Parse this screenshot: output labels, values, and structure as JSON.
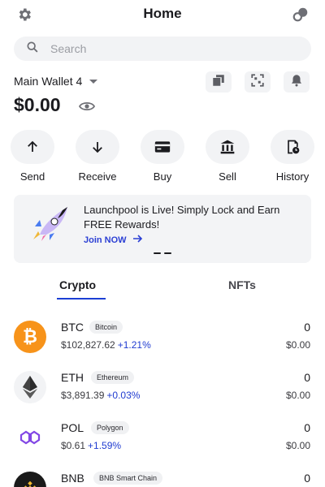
{
  "header": {
    "title": "Home",
    "settings_icon": "gear-icon",
    "connect_icon": "link-icon"
  },
  "search": {
    "placeholder": "Search",
    "icon": "search-icon"
  },
  "wallet": {
    "name": "Main Wallet 4",
    "balance": "$0.00",
    "actions_icons": [
      "copy-icon",
      "scan-icon",
      "bell-icon"
    ]
  },
  "actions": [
    {
      "label": "Send",
      "icon": "arrow-up-icon"
    },
    {
      "label": "Receive",
      "icon": "arrow-down-icon"
    },
    {
      "label": "Buy",
      "icon": "card-icon"
    },
    {
      "label": "Sell",
      "icon": "bank-icon"
    },
    {
      "label": "History",
      "icon": "history-icon"
    }
  ],
  "banner": {
    "text": "Launchpool is Live! Simply Lock and Earn FREE Rewards!",
    "cta": "Join NOW"
  },
  "tabs": [
    {
      "label": "Crypto",
      "active": true
    },
    {
      "label": "NFTs",
      "active": false
    }
  ],
  "assets": [
    {
      "symbol": "BTC",
      "name": "Bitcoin",
      "price": "$102,827.62",
      "change": "+1.21%",
      "amount": "0",
      "value": "$0.00",
      "color": "#f7931a"
    },
    {
      "symbol": "ETH",
      "name": "Ethereum",
      "price": "$3,891.39",
      "change": "+0.03%",
      "amount": "0",
      "value": "$0.00",
      "color": "#2c2c2c"
    },
    {
      "symbol": "POL",
      "name": "Polygon",
      "price": "$0.61",
      "change": "+1.59%",
      "amount": "0",
      "value": "$0.00",
      "color": "#8247e5"
    },
    {
      "symbol": "BNB",
      "name": "BNB Smart Chain",
      "price": "",
      "change": "",
      "amount": "0",
      "value": "",
      "color": "#f3ba2f"
    }
  ]
}
